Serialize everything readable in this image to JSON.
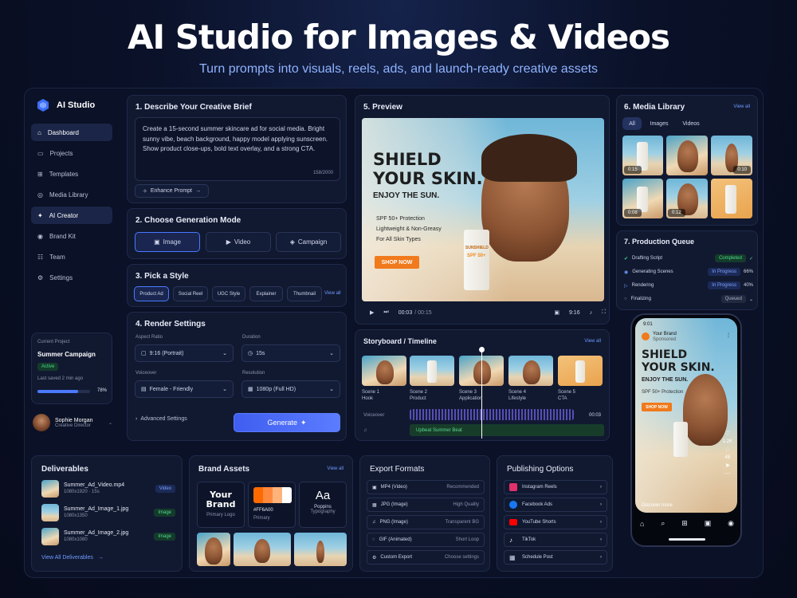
{
  "hero": {
    "title": "AI Studio for Images & Videos",
    "subtitle": "Turn prompts into visuals, reels, ads, and launch-ready creative assets"
  },
  "sidebar": {
    "brand": "AI Studio",
    "items": [
      {
        "label": "Dashboard",
        "icon": "home-icon",
        "active": true
      },
      {
        "label": "Projects",
        "icon": "folder-icon"
      },
      {
        "label": "Templates",
        "icon": "grid-icon"
      },
      {
        "label": "Media Library",
        "icon": "media-icon"
      },
      {
        "label": "AI Creator",
        "icon": "sparkle-icon",
        "active": true
      },
      {
        "label": "Brand Kit",
        "icon": "brand-icon"
      },
      {
        "label": "Team",
        "icon": "team-icon"
      },
      {
        "label": "Settings",
        "icon": "gear-icon"
      }
    ],
    "project": {
      "caption": "Current Project",
      "name": "Summer Campaign",
      "status": "Active",
      "saved": "Last saved 2 min ago",
      "progress": "78%",
      "progress_value": 0.78
    },
    "user": {
      "name": "Sophie Morgan",
      "role": "Creative Director"
    }
  },
  "brief": {
    "title": "1. Describe Your Creative Brief",
    "text": "Create a 15-second summer skincare ad for social media. Bright sunny vibe, beach background, happy model applying sunscreen. Show product close-ups, bold text overlay, and a strong CTA.",
    "counter": "158/2000",
    "enhance": "Enhance Prompt"
  },
  "mode": {
    "title": "2. Choose Generation Mode",
    "options": [
      "Image",
      "Video",
      "Campaign"
    ],
    "selected": "Image"
  },
  "style": {
    "title": "3. Pick a Style",
    "options": [
      "Product Ad",
      "Social Reel",
      "UGC Style",
      "Explainer",
      "Thumbnail"
    ],
    "view_all": "View all"
  },
  "render": {
    "title": "4. Render Settings",
    "aspect_label": "Aspect Ratio",
    "aspect_value": "9:16 (Portrait)",
    "duration_label": "Duration",
    "duration_value": "15s",
    "voice_label": "Voiceover",
    "voice_value": "Female - Friendly",
    "resolution_label": "Resolution",
    "resolution_value": "1080p (Full HD)",
    "advanced": "Advanced Settings",
    "generate": "Generate"
  },
  "preview": {
    "title": "5. Preview",
    "headline1": "SHIELD",
    "headline2": "YOUR SKIN.",
    "tagline": "ENJOY THE SUN.",
    "features": [
      "SPF 50+ Protection",
      "Lightweight & Non-Greasy",
      "For All Skin Types"
    ],
    "cta": "SHOP NOW",
    "bottle_brand": "SUNSHIELD",
    "bottle_spf": "SPF 50+",
    "time": "00:03",
    "duration": "/ 00:15",
    "ratio": "9:16"
  },
  "storyboard": {
    "title": "Storyboard / Timeline",
    "view_all": "View all",
    "scenes": [
      {
        "num": "Scene 1",
        "name": "Hook"
      },
      {
        "num": "Scene 2",
        "name": "Product"
      },
      {
        "num": "Scene 3",
        "name": "Application"
      },
      {
        "num": "Scene 4",
        "name": "Lifestyle"
      },
      {
        "num": "Scene 5",
        "name": "CTA"
      }
    ],
    "voiceover_label": "Voiceover",
    "voiceover_time": "00:03",
    "music": "Upbeat Summer Beat"
  },
  "library": {
    "title": "6. Media Library",
    "view_all": "View all",
    "tabs": [
      "All",
      "Images",
      "Videos"
    ],
    "active_tab": "All",
    "items": [
      {
        "time": "0:15"
      },
      {
        "time": ""
      },
      {
        "time": "0:10"
      },
      {
        "time": "0:08"
      },
      {
        "time": "0:12"
      },
      {
        "time": ""
      }
    ]
  },
  "queue": {
    "title": "7. Production Queue",
    "items": [
      {
        "label": "Drafting Script",
        "status": "Completed",
        "pct": ""
      },
      {
        "label": "Generating Scenes",
        "status": "In Progress",
        "pct": "66%"
      },
      {
        "label": "Rendering",
        "status": "In Progress",
        "pct": "40%"
      },
      {
        "label": "Finalizing",
        "status": "Queued",
        "pct": ""
      }
    ]
  },
  "phone": {
    "time": "9:01",
    "account": "Your Brand",
    "account_sub": "Sponsored",
    "headline1": "SHIELD",
    "headline2": "YOUR SKIN.",
    "tagline": "ENJOY THE SUN.",
    "feature": "SPF 50+ Protection",
    "cta": "SHOP NOW",
    "caption": "Discover more",
    "likes": "1.2K",
    "comments": "48"
  },
  "deliverables": {
    "title": "Deliverables",
    "files": [
      {
        "name": "Summer_Ad_Video.mp4",
        "size": "1080x1920 · 15s",
        "type": "Video"
      },
      {
        "name": "Summer_Ad_Image_1.jpg",
        "size": "1080x1350",
        "type": "Image"
      },
      {
        "name": "Summer_Ad_Image_2.jpg",
        "size": "1080x1080",
        "type": "Image"
      }
    ],
    "view_all": "View All Deliverables"
  },
  "brand_assets": {
    "title": "Brand Assets",
    "view_all": "View all",
    "logo_text1": "Your",
    "logo_text2": "Brand",
    "logo_label": "Primary Logo",
    "color_hex": "#FF6A00",
    "color_label": "Primary",
    "font_sample": "Aa",
    "font_name": "Poppins",
    "font_label": "Typography",
    "palette": [
      "#ff6a00",
      "#ff8a3d",
      "#ffb37a",
      "#ffffff"
    ]
  },
  "export": {
    "title": "Export Formats",
    "items": [
      {
        "label": "MP4 (Video)",
        "note": "Recommended"
      },
      {
        "label": "JPG (Image)",
        "note": "High Quality"
      },
      {
        "label": "PNG (Image)",
        "note": "Transparent BG"
      },
      {
        "label": "GIF (Animated)",
        "note": "Short Loop"
      },
      {
        "label": "Custom Export",
        "note": "Choose settings"
      }
    ]
  },
  "publishing": {
    "title": "Publishing Options",
    "items": [
      {
        "label": "Instagram Reels",
        "color": "#e1306c"
      },
      {
        "label": "Facebook Ads",
        "color": "#1877f2"
      },
      {
        "label": "YouTube Shorts",
        "color": "#ff0000"
      },
      {
        "label": "TikTok",
        "color": "#111111"
      },
      {
        "label": "Schedule Post",
        "color": "#5b6478"
      }
    ]
  }
}
